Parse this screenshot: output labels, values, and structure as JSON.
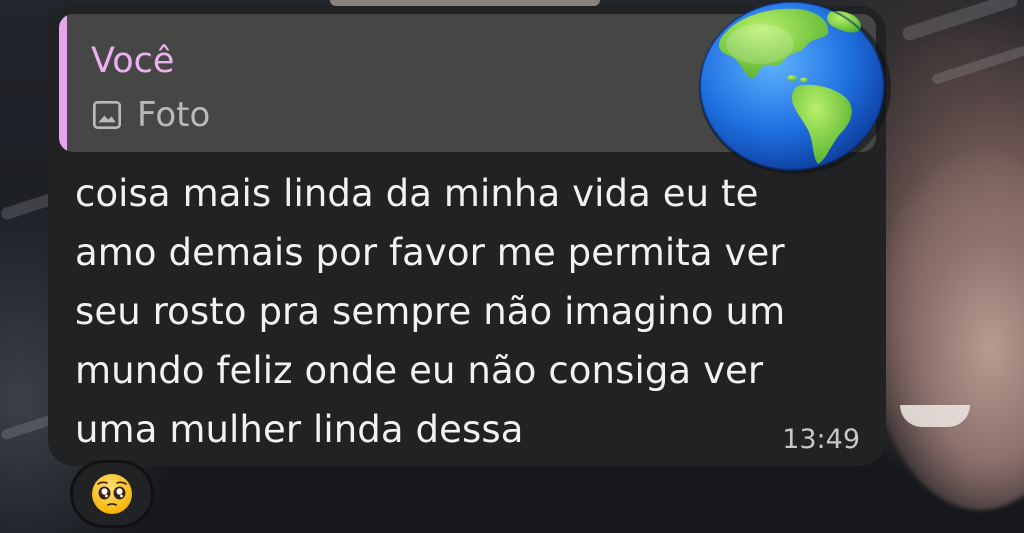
{
  "message": {
    "reply": {
      "author": "Você",
      "type_label": "Foto",
      "type_icon": "image-icon",
      "accent_color": "#e7a4ee"
    },
    "text": "coisa mais linda da minha vida eu te\namo demais por favor me permita ver\nseu rosto pra sempre não imagino um\nmundo feliz onde eu não consiga ver\numa mulher linda dessa",
    "time": "13:49",
    "reaction": {
      "icon": "pleading-face-emoji"
    }
  },
  "sticker": {
    "icon": "globe-americas-emoji"
  },
  "colors": {
    "bubble": "#202224",
    "quote_bg": "#464745",
    "author": "#ecb0f0",
    "text": "#f2f2f2"
  }
}
